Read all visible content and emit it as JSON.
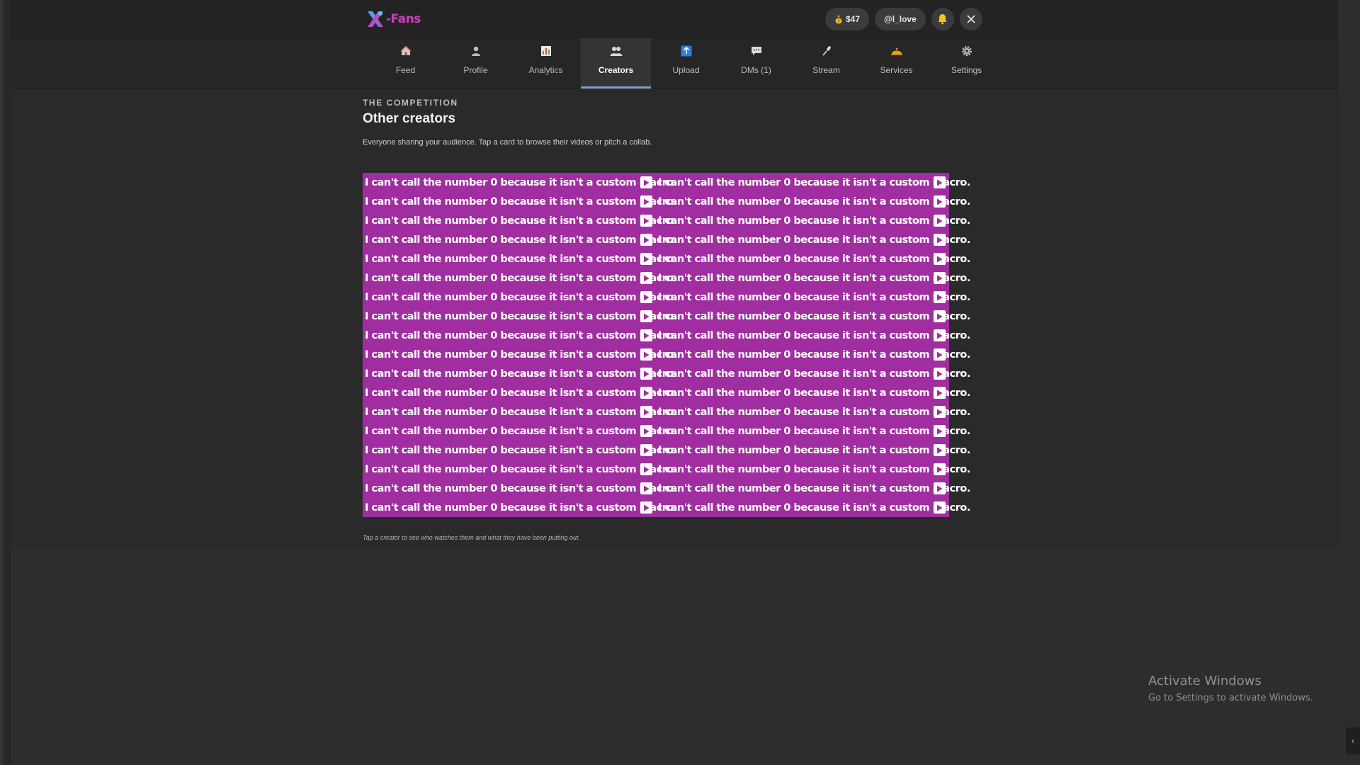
{
  "app": {
    "logo_text": "-Fans",
    "balance": "$47",
    "username": "@l_love"
  },
  "nav": {
    "items": [
      {
        "label": "Feed",
        "icon": "home-icon"
      },
      {
        "label": "Profile",
        "icon": "user-icon"
      },
      {
        "label": "Analytics",
        "icon": "chart-icon"
      },
      {
        "label": "Creators",
        "icon": "people-icon",
        "active": true
      },
      {
        "label": "Upload",
        "icon": "upload-icon"
      },
      {
        "label": "DMs (1)",
        "icon": "chat-icon"
      },
      {
        "label": "Stream",
        "icon": "microphone-icon"
      },
      {
        "label": "Services",
        "icon": "bell-service-icon"
      },
      {
        "label": "Settings",
        "icon": "gear-icon"
      }
    ]
  },
  "page": {
    "eyebrow": "THE COMPETITION",
    "title": "Other creators",
    "subtitle": "Everyone sharing your audience. Tap a card to browse their videos or pitch a collab.",
    "footnote": "Tap a creator to see who watches them and what they have been putting out."
  },
  "creators": {
    "card_text": "I can't call the number 0 because it isn't a custom macro.",
    "rows": 18,
    "columns": 2,
    "card_color": "#a02ea0"
  },
  "watermark": {
    "title": "Activate Windows",
    "subtitle": "Go to Settings to activate Windows."
  },
  "colors": {
    "accent": "#7a9fc6",
    "brand": "#c43fb6",
    "notification": "#f5c518"
  }
}
